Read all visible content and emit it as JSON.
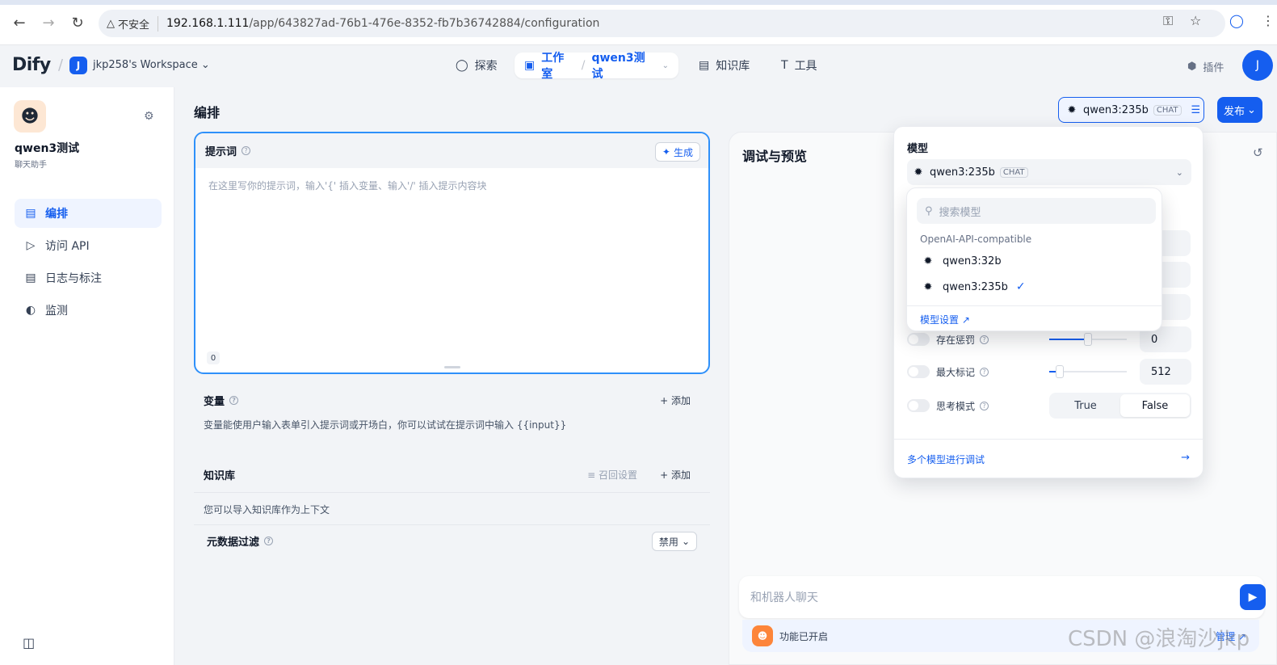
{
  "browser": {
    "insecure_label": "不安全",
    "url_host": "192.168.1.111",
    "url_path": "/app/643827ad-76b1-476e-8352-fb7b36742884/configuration"
  },
  "header": {
    "logo": "Dify",
    "workspace_initial": "J",
    "workspace_name": "jkp258's Workspace",
    "nav": {
      "explore": "探索",
      "studio": "工作室",
      "app_name": "qwen3测试",
      "knowledge": "知识库",
      "tools": "工具"
    },
    "plugins": "插件",
    "user_initial": "J"
  },
  "sidebar": {
    "app_name": "qwen3测试",
    "app_type": "聊天助手",
    "items": [
      {
        "label": "编排",
        "icon": "layout-icon",
        "active": true
      },
      {
        "label": "访问 API",
        "icon": "terminal-icon",
        "active": false
      },
      {
        "label": "日志与标注",
        "icon": "document-icon",
        "active": false
      },
      {
        "label": "监测",
        "icon": "gauge-icon",
        "active": false
      }
    ]
  },
  "main": {
    "title": "编排",
    "prompt": {
      "label": "提示词",
      "generate": "生成",
      "placeholder": "在这里写你的提示词，输入'{' 插入变量、输入'/' 插入提示内容块",
      "count": "0"
    },
    "variables": {
      "label": "变量",
      "add": "添加",
      "description": "变量能使用户输入表单引入提示词或开场白，你可以试试在提示词中输入 {{input}}"
    },
    "knowledge": {
      "label": "知识库",
      "recall": "召回设置",
      "add": "添加",
      "description": "您可以导入知识库作为上下文",
      "metadata_filter": "元数据过滤",
      "metadata_value": "禁用"
    }
  },
  "debug": {
    "title": "调试与预览",
    "chat_placeholder": "和机器人聊天",
    "features": "功能已开启",
    "manage": "管理"
  },
  "model_bar": {
    "model": "qwen3:235b",
    "tag": "CHAT",
    "publish": "发布"
  },
  "model_panel": {
    "label": "模型",
    "selected": "qwen3:235b",
    "tag": "CHAT",
    "params": [
      {
        "label": "存在惩罚",
        "value": "0",
        "fill": 0.5
      },
      {
        "label": "最大标记",
        "value": "512",
        "fill": 0.14
      }
    ],
    "thinking": {
      "label": "思考模式",
      "true_label": "True",
      "false_label": "False",
      "selected": "False"
    },
    "multi_model": "多个模型进行调试"
  },
  "model_dropdown": {
    "search_placeholder": "搜索模型",
    "provider": "OpenAI-API-compatible",
    "models": [
      "qwen3:32b",
      "qwen3:235b"
    ],
    "selected": "qwen3:235b",
    "settings": "模型设置 ↗"
  },
  "watermark": "CSDN @浪淘沙jkp"
}
